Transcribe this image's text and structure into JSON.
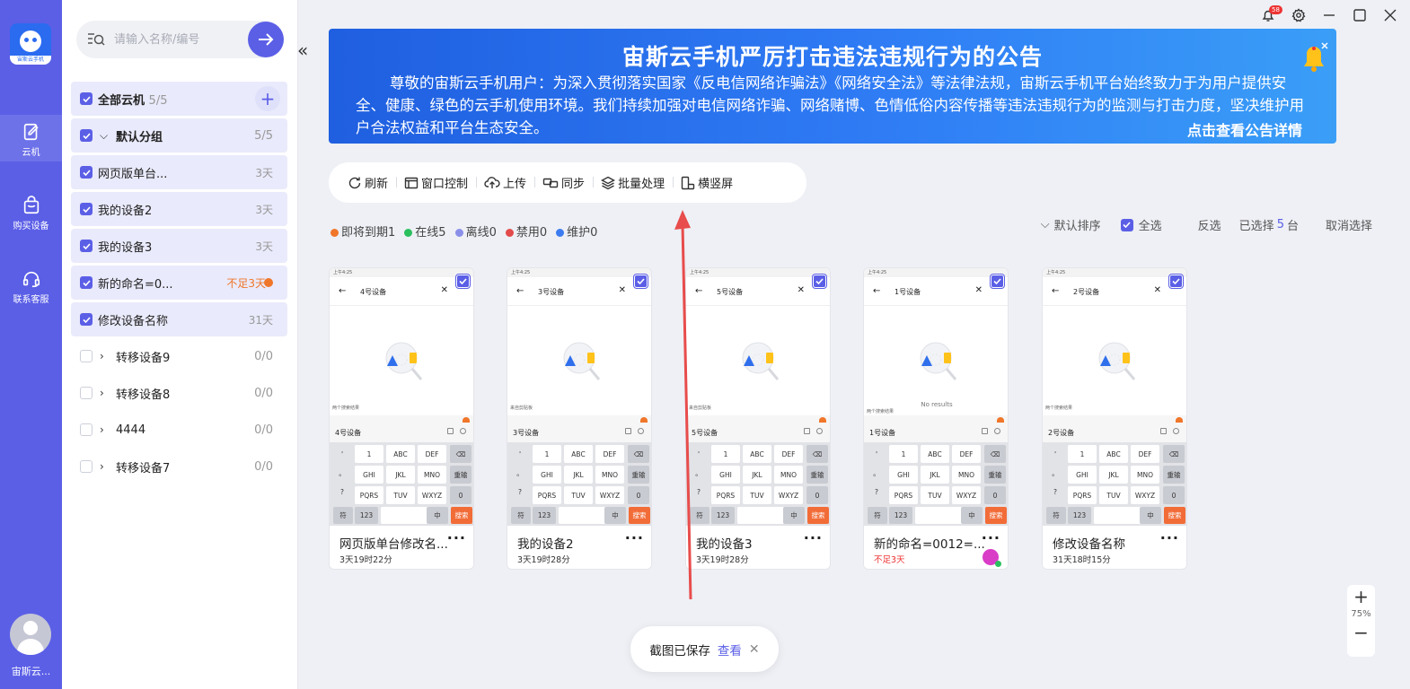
{
  "rail": {
    "logo_caption": "宙斯云手机",
    "items": [
      {
        "label": "云机",
        "icon": "cloud-phone-icon"
      },
      {
        "label": "购买设备",
        "icon": "shopping-bag-icon"
      },
      {
        "label": "联系客服",
        "icon": "headset-icon"
      }
    ],
    "user_name": "宙斯云..."
  },
  "sidebar": {
    "search_placeholder": "请输入名称/编号",
    "all_group": {
      "label": "全部云机",
      "count": "5/5"
    },
    "default_group": {
      "label": "默认分组",
      "count": "5/5"
    },
    "devices": [
      {
        "label": "网页版单台...",
        "days": "3天"
      },
      {
        "label": "我的设备2",
        "days": "3天"
      },
      {
        "label": "我的设备3",
        "days": "3天"
      },
      {
        "label": "新的命名=0...",
        "days": "不足3天"
      },
      {
        "label": "修改设备名称",
        "days": "31天"
      }
    ],
    "groups": [
      {
        "label": "转移设备9",
        "count": "0/0"
      },
      {
        "label": "转移设备8",
        "count": "0/0"
      },
      {
        "label": "4444",
        "count": "0/0"
      },
      {
        "label": "转移设备7",
        "count": "0/0"
      }
    ]
  },
  "window": {
    "notify_count": "58"
  },
  "banner": {
    "title": "宙斯云手机严厉打击违法违规行为的公告",
    "body": "尊敬的宙斯云手机用户：为深入贯彻落实国家《反电信网络诈骗法》《网络安全法》等法律法规，宙斯云手机平台始终致力于为用户提供安全、健康、绿色的云手机使用环境。我们持续加强对电信网络诈骗、网络赌博、色情低俗内容传播等违法违规行为的监测与打击力度，坚决维护用户合法权益和平台生态安全。",
    "link": "点击查看公告详情"
  },
  "toolbar": {
    "refresh": "刷新",
    "window_control": "窗口控制",
    "upload": "上传",
    "sync": "同步",
    "batch": "批量处理",
    "orientation": "横竖屏"
  },
  "status": {
    "expiring": "即将到期1",
    "online": "在线5",
    "offline": "离线0",
    "disabled": "禁用0",
    "maintenance": "维护0",
    "colors": {
      "expiring": "#f0762a",
      "online": "#2bbf5e",
      "offline": "#8a8fe8",
      "disabled": "#e34b4b",
      "maintenance": "#3c7cf0"
    }
  },
  "sort": {
    "default_sort": "默认排序",
    "select_all": "全选",
    "invert": "反选",
    "selected_prefix": "已选择",
    "selected_count": "5",
    "selected_unit": "台",
    "cancel": "取消选择"
  },
  "cards": [
    {
      "search_text": "4号设备",
      "input_label": "4号设备",
      "name": "网页版单台修改名...",
      "time": "3天19时22分",
      "warn": false,
      "no_results": "",
      "suggest": "两个搜索结果"
    },
    {
      "search_text": "3号设备",
      "input_label": "3号设备",
      "name": "我的设备2",
      "time": "3天19时28分",
      "warn": false,
      "no_results": "",
      "suggest": "来自剪贴板"
    },
    {
      "search_text": "5号设备",
      "input_label": "5号设备",
      "name": "我的设备3",
      "time": "3天19时28分",
      "warn": false,
      "no_results": "",
      "suggest": "来自剪贴板"
    },
    {
      "search_text": "1号设备",
      "input_label": "1号设备",
      "name": "新的命名=0012=...",
      "time": "不足3天",
      "warn": true,
      "no_results": "No results",
      "suggest": "两个搜索结果"
    },
    {
      "search_text": "2号设备",
      "input_label": "2号设备",
      "name": "修改设备名称",
      "time": "31天18时15分",
      "warn": false,
      "no_results": "",
      "suggest": "两个搜索结果"
    }
  ],
  "keyboard": {
    "rows": [
      [
        "1",
        "ABC",
        "DEF"
      ],
      [
        "GHI",
        "JKL",
        "MNO"
      ],
      [
        "PQRS",
        "TUV",
        "WXYZ"
      ]
    ],
    "side": [
      "'",
      "。",
      "?",
      "!"
    ],
    "right": [
      "⌫",
      "重输",
      "0"
    ],
    "bottom": [
      "符",
      "123",
      "",
      "中",
      "搜索"
    ]
  },
  "phone_status": "上午4:25",
  "zoom": {
    "plus": "+",
    "value": "75%",
    "minus": "−"
  },
  "toast": {
    "text": "截图已保存",
    "link": "查看"
  }
}
